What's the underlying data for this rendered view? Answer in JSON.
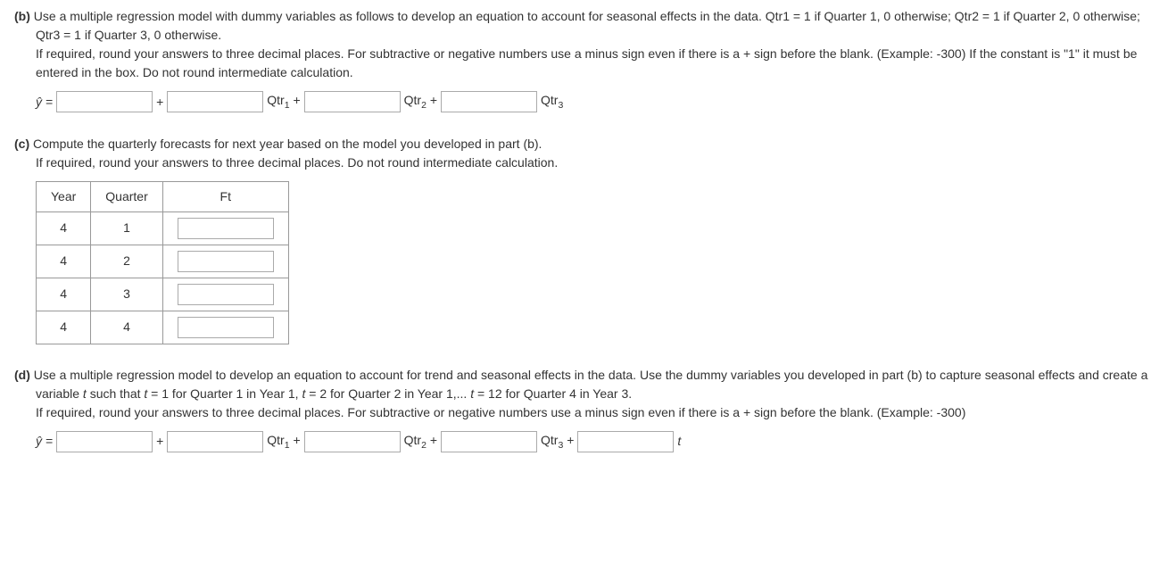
{
  "parts": {
    "b": {
      "label": "(b)",
      "text1": "Use a multiple regression model with dummy variables as follows to develop an equation to account for seasonal effects in the data. Qtr1 = 1 if Quarter 1, 0 otherwise; Qtr2 = 1 if Quarter 2, 0 otherwise; Qtr3 = 1 if Quarter 3, 0 otherwise.",
      "text2": "If required, round your answers to three decimal places. For subtractive or negative numbers use a minus sign even if there is a + sign before the blank. (Example: -300) If the constant is \"1\" it must be entered in the box. Do not round intermediate calculation.",
      "eq": {
        "yhat": "ŷ =",
        "plus": "+",
        "qtr1": "Qtr",
        "qtr1s": "1",
        "qtr2": "Qtr",
        "qtr2s": "2",
        "qtr3": "Qtr",
        "qtr3s": "3"
      }
    },
    "c": {
      "label": "(c)",
      "text1": "Compute the quarterly forecasts for next year based on the model you developed in part (b).",
      "text2": "If required, round your answers to three decimal places. Do not round intermediate calculation.",
      "headers": {
        "year": "Year",
        "quarter": "Quarter",
        "ft": "Ft"
      },
      "rows": [
        {
          "year": "4",
          "quarter": "1"
        },
        {
          "year": "4",
          "quarter": "2"
        },
        {
          "year": "4",
          "quarter": "3"
        },
        {
          "year": "4",
          "quarter": "4"
        }
      ]
    },
    "d": {
      "label": "(d)",
      "text1": "Use a multiple regression model to develop an equation to account for trend and seasonal effects in the data. Use the dummy variables you developed in part (b) to capture seasonal effects and create a variable t such that t = 1 for Quarter 1 in Year 1, t = 2 for Quarter 2 in Year 1,... t = 12 for Quarter 4 in Year 3.",
      "text2": "If required, round your answers to three decimal places. For subtractive or negative numbers use a minus sign even if there is a + sign before the blank. (Example: -300)",
      "eq": {
        "yhat": "ŷ =",
        "plus": "+",
        "qtr1": "Qtr",
        "qtr1s": "1",
        "qtr2": "Qtr",
        "qtr2s": "2",
        "qtr3": "Qtr",
        "qtr3s": "3",
        "t": "t"
      }
    }
  }
}
